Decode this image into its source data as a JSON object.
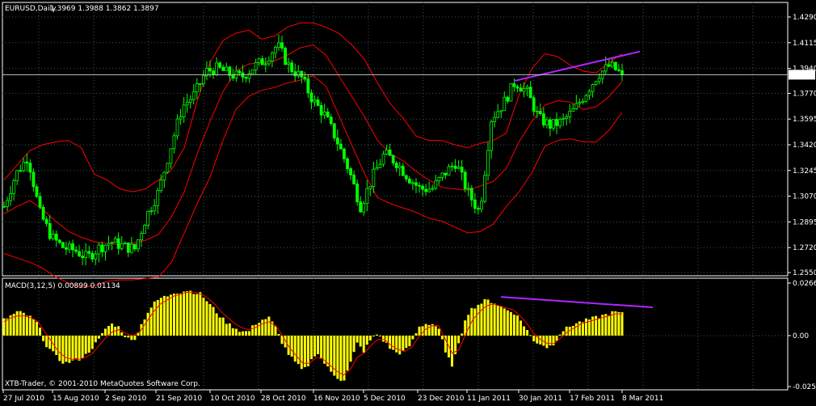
{
  "chart_data": [
    {
      "type": "candlestick",
      "symbol_title": "EURUSD,Daily",
      "ohlc_header": "1.3969 1.3988 1.3862 1.3897",
      "current_price_label": "1.3897",
      "current_price": 1.3897,
      "ylim": [
        1.255,
        1.429
      ],
      "y_ticks": [
        "1.4290",
        "1.4115",
        "1.3940",
        "1.3770",
        "1.3595",
        "1.3420",
        "1.3245",
        "1.3070",
        "1.2895",
        "1.2720",
        "1.2550"
      ],
      "grid": true,
      "colors": {
        "bull": "#00ff00",
        "bear": "#00ff00",
        "bands": "#ff0000",
        "trendline": "#b026ff",
        "grid": "#2d5a5a",
        "axis": "#ffffff"
      },
      "bollinger": {
        "upper": [
          1.318,
          1.328,
          1.338,
          1.342,
          1.344,
          1.345,
          1.34,
          1.322,
          1.318,
          1.312,
          1.31,
          1.312,
          1.318,
          1.325,
          1.34,
          1.372,
          1.398,
          1.413,
          1.418,
          1.42,
          1.414,
          1.416,
          1.422,
          1.425,
          1.425,
          1.422,
          1.418,
          1.41,
          1.4,
          1.384,
          1.37,
          1.36,
          1.348,
          1.345,
          1.345,
          1.342,
          1.34,
          1.343,
          1.345,
          1.35,
          1.376,
          1.394,
          1.404,
          1.402,
          1.396,
          1.392,
          1.391,
          1.398,
          1.404
        ],
        "middle": [
          1.295,
          1.3,
          1.304,
          1.298,
          1.29,
          1.283,
          1.279,
          1.276,
          1.275,
          1.274,
          1.275,
          1.277,
          1.281,
          1.293,
          1.31,
          1.336,
          1.358,
          1.378,
          1.392,
          1.397,
          1.398,
          1.399,
          1.403,
          1.408,
          1.41,
          1.403,
          1.389,
          1.375,
          1.361,
          1.345,
          1.336,
          1.331,
          1.324,
          1.318,
          1.313,
          1.312,
          1.311,
          1.314,
          1.317,
          1.326,
          1.344,
          1.358,
          1.369,
          1.372,
          1.371,
          1.366,
          1.368,
          1.375,
          1.385
        ],
        "lower": [
          1.268,
          1.265,
          1.262,
          1.258,
          1.252,
          1.248,
          1.245,
          1.246,
          1.249,
          1.25,
          1.25,
          1.251,
          1.252,
          1.262,
          1.282,
          1.302,
          1.32,
          1.345,
          1.366,
          1.375,
          1.379,
          1.381,
          1.384,
          1.386,
          1.389,
          1.382,
          1.362,
          1.342,
          1.322,
          1.306,
          1.302,
          1.299,
          1.296,
          1.292,
          1.29,
          1.286,
          1.282,
          1.283,
          1.288,
          1.3,
          1.31,
          1.323,
          1.341,
          1.345,
          1.346,
          1.344,
          1.344,
          1.352,
          1.364
        ]
      },
      "trendline": {
        "from": [
          1.3854
        ],
        "to": [
          1.4055
        ]
      },
      "x_labels": [
        "27 Jul 2010",
        "15 Aug 2010",
        "2 Sep 2010",
        "21 Sep 2010",
        "10 Oct 2010",
        "28 Oct 2010",
        "16 Nov 2010",
        "5 Dec 2010",
        "23 Dec 2010",
        "11 Jan 2011",
        "30 Jan 2011",
        "17 Feb 2011",
        "8 Mar 2011"
      ],
      "close_path": [
        1.3,
        1.322,
        1.334,
        1.296,
        1.279,
        1.272,
        1.27,
        1.265,
        1.272,
        1.276,
        1.273,
        1.271,
        1.294,
        1.31,
        1.34,
        1.368,
        1.376,
        1.392,
        1.394,
        1.39,
        1.388,
        1.395,
        1.4,
        1.41,
        1.395,
        1.388,
        1.372,
        1.362,
        1.345,
        1.325,
        1.3,
        1.32,
        1.336,
        1.33,
        1.32,
        1.312,
        1.312,
        1.322,
        1.33,
        1.31,
        1.296,
        1.36,
        1.37,
        1.385,
        1.378,
        1.36,
        1.355,
        1.358,
        1.366,
        1.378,
        1.39,
        1.396,
        1.3897
      ]
    },
    {
      "type": "bar",
      "title": "MACD(3,12,5) 0.00899 0.01134",
      "ylim": [
        -0.02582,
        0.02661
      ],
      "y_ticks": [
        "0.02661",
        "0.00",
        "-0.02582"
      ],
      "colors": {
        "histogram": "#ffff00",
        "signal": "#ff0000",
        "trendline": "#b026ff"
      },
      "histogram": [
        0.008,
        0.01,
        0.012,
        0.011,
        0.009,
        0.006,
        -0.004,
        -0.008,
        -0.012,
        -0.014,
        -0.013,
        -0.012,
        -0.01,
        -0.006,
        -0.002,
        0.004,
        0.006,
        0.004,
        -0.001,
        -0.003,
        0.004,
        0.011,
        0.016,
        0.019,
        0.02,
        0.022,
        0.022,
        0.023,
        0.022,
        0.021,
        0.017,
        0.013,
        0.009,
        0.006,
        0.004,
        0.002,
        0.002,
        0.006,
        0.008,
        0.009,
        0.004,
        -0.004,
        -0.01,
        -0.014,
        -0.018,
        -0.014,
        -0.008,
        -0.013,
        -0.018,
        -0.021,
        -0.023,
        -0.014,
        -0.004,
        -0.008,
        -0.002,
        0.001,
        -0.003,
        -0.007,
        -0.009,
        -0.008,
        -0.004,
        0.004,
        0.006,
        0.006,
        0.004,
        -0.009,
        -0.015,
        -0.004,
        0.01,
        0.014,
        0.016,
        0.018,
        0.017,
        0.015,
        0.013,
        0.012,
        0.008,
        0.003,
        -0.003,
        -0.004,
        -0.006,
        -0.004,
        0.002,
        0.004,
        0.006,
        0.007,
        0.008,
        0.009,
        0.01,
        0.011,
        0.012,
        0.011
      ],
      "signal": [
        0.007,
        0.009,
        0.01,
        0.01,
        0.009,
        0.007,
        0.002,
        -0.003,
        -0.008,
        -0.011,
        -0.012,
        -0.012,
        -0.011,
        -0.009,
        -0.005,
        -0.001,
        0.002,
        0.003,
        0.001,
        0.0,
        0.002,
        0.007,
        0.012,
        0.016,
        0.018,
        0.02,
        0.021,
        0.022,
        0.022,
        0.021,
        0.019,
        0.016,
        0.012,
        0.009,
        0.006,
        0.004,
        0.003,
        0.004,
        0.006,
        0.007,
        0.005,
        0.0,
        -0.006,
        -0.01,
        -0.014,
        -0.014,
        -0.011,
        -0.012,
        -0.015,
        -0.018,
        -0.02,
        -0.017,
        -0.011,
        -0.009,
        -0.005,
        -0.002,
        -0.002,
        -0.005,
        -0.007,
        -0.008,
        -0.006,
        -0.001,
        0.003,
        0.005,
        0.005,
        -0.002,
        -0.009,
        -0.007,
        0.001,
        0.008,
        0.012,
        0.015,
        0.016,
        0.015,
        0.014,
        0.013,
        0.01,
        0.006,
        0.001,
        -0.002,
        -0.004,
        -0.004,
        -0.001,
        0.002,
        0.004,
        0.006,
        0.007,
        0.008,
        0.009,
        0.01,
        0.011,
        0.011
      ],
      "trendline": {
        "from": [
          0.0196
        ],
        "to": [
          0.0143
        ]
      }
    }
  ],
  "footer_copyright": "XTB-Trader, © 2001-2010 MetaQuotes Software Corp."
}
